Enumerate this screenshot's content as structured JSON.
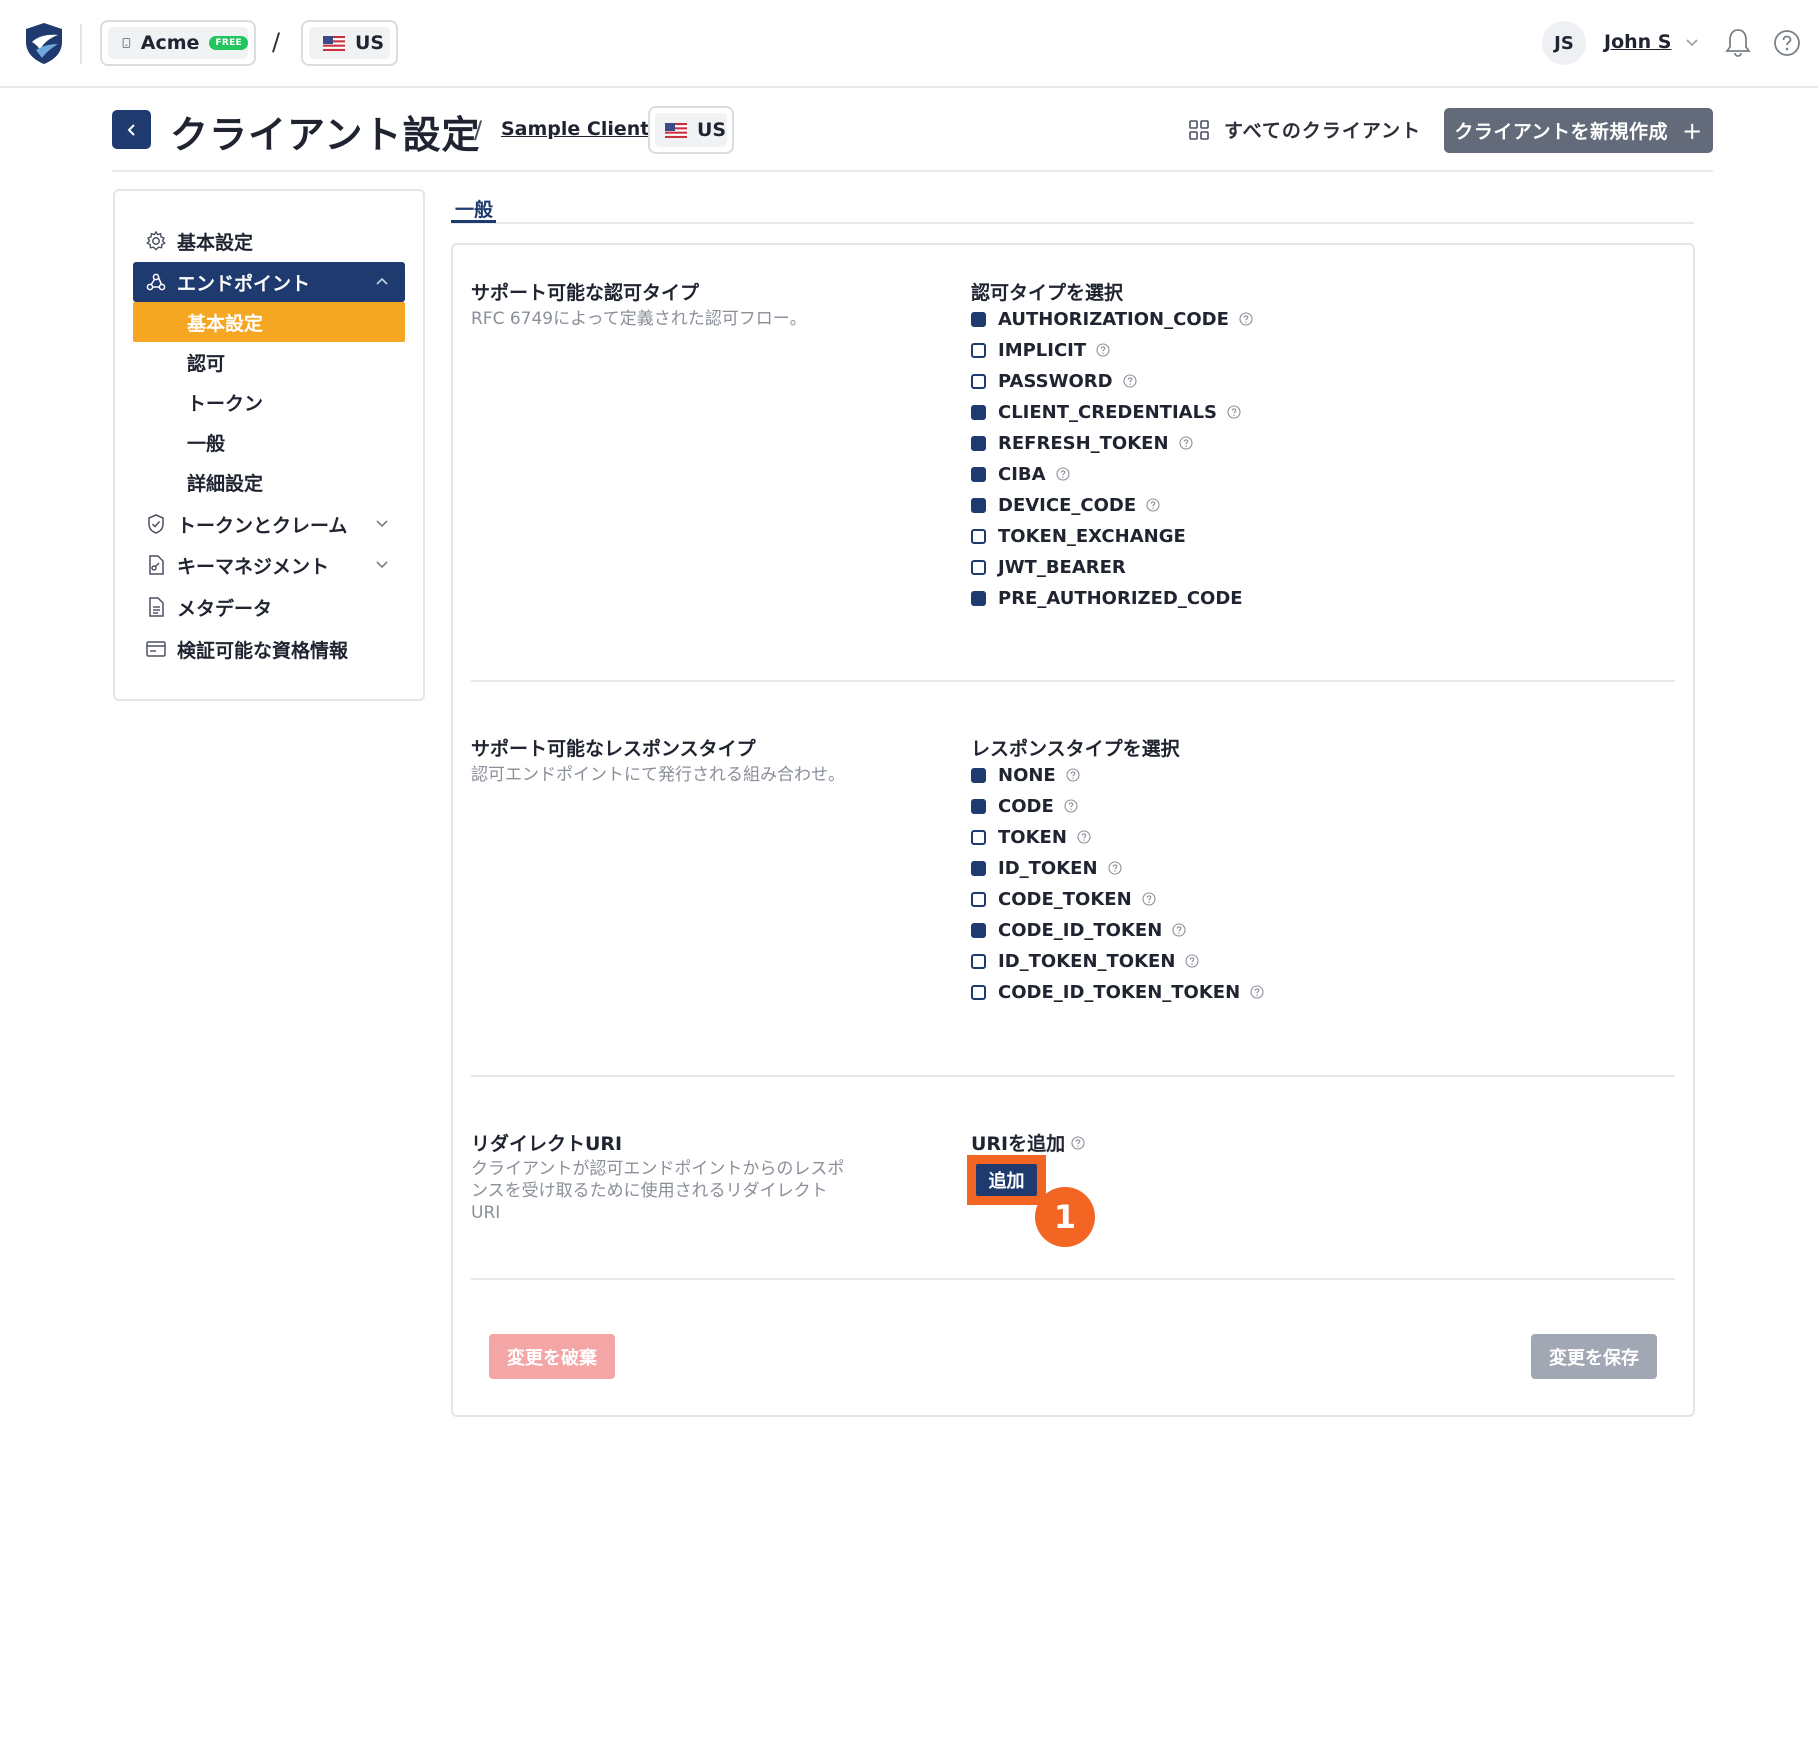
{
  "topbar": {
    "org_name": "Acme",
    "org_badge": "FREE",
    "separator": "/",
    "region": "US",
    "user_initials": "JS",
    "user_name": "John S"
  },
  "header": {
    "title": "クライアント設定",
    "separator": "/",
    "client_name": "Sample Client",
    "region": "US",
    "all_clients_label": "すべてのクライアント",
    "new_client_label": "クライアントを新規作成",
    "new_client_plus": "+"
  },
  "sidebar": {
    "items": [
      {
        "label": "基本設定",
        "icon": "gear-icon"
      },
      {
        "label": "エンドポイント",
        "icon": "webhook-icon",
        "active": true
      },
      {
        "label": "トークンとクレーム",
        "icon": "shield-check-icon"
      },
      {
        "label": "キーマネジメント",
        "icon": "key-file-icon"
      },
      {
        "label": "メタデータ",
        "icon": "document-icon"
      },
      {
        "label": "検証可能な資格情報",
        "icon": "credential-card-icon"
      }
    ],
    "sub_items": [
      {
        "label": "基本設定",
        "active": true
      },
      {
        "label": "認可"
      },
      {
        "label": "トークン"
      },
      {
        "label": "一般"
      },
      {
        "label": "詳細設定"
      }
    ]
  },
  "tabs": {
    "active": "一般"
  },
  "grant_types": {
    "title": "サポート可能な認可タイプ",
    "description": "RFC 6749によって定義された認可フロー。",
    "select_label": "認可タイプを選択",
    "options": [
      {
        "label": "AUTHORIZATION_CODE",
        "checked": true,
        "help": true
      },
      {
        "label": "IMPLICIT",
        "checked": false,
        "help": true
      },
      {
        "label": "PASSWORD",
        "checked": false,
        "help": true
      },
      {
        "label": "CLIENT_CREDENTIALS",
        "checked": true,
        "help": true
      },
      {
        "label": "REFRESH_TOKEN",
        "checked": true,
        "help": true
      },
      {
        "label": "CIBA",
        "checked": true,
        "help": true
      },
      {
        "label": "DEVICE_CODE",
        "checked": true,
        "help": true
      },
      {
        "label": "TOKEN_EXCHANGE",
        "checked": false,
        "help": false
      },
      {
        "label": "JWT_BEARER",
        "checked": false,
        "help": false
      },
      {
        "label": "PRE_AUTHORIZED_CODE",
        "checked": true,
        "help": false
      }
    ]
  },
  "response_types": {
    "title": "サポート可能なレスポンスタイプ",
    "description": "認可エンドポイントにて発行される組み合わせ。",
    "select_label": "レスポンスタイプを選択",
    "options": [
      {
        "label": "NONE",
        "checked": true
      },
      {
        "label": "CODE",
        "checked": true
      },
      {
        "label": "TOKEN",
        "checked": false
      },
      {
        "label": "ID_TOKEN",
        "checked": true
      },
      {
        "label": "CODE_TOKEN",
        "checked": false
      },
      {
        "label": "CODE_ID_TOKEN",
        "checked": true
      },
      {
        "label": "ID_TOKEN_TOKEN",
        "checked": false
      },
      {
        "label": "CODE_ID_TOKEN_TOKEN",
        "checked": false
      }
    ]
  },
  "redirect_uri": {
    "title": "リダイレクトURI",
    "description_line1": "クライアントが認可エンドポイントからのレスポ",
    "description_line2": "ンスを受け取るために使用されるリダイレクト",
    "description_line3": "URI",
    "add_label": "URIを追加",
    "add_button": "追加",
    "step_number": "1"
  },
  "footer": {
    "discard_label": "変更を破棄",
    "save_label": "変更を保存"
  },
  "colors": {
    "primary": "#1e3a6e",
    "accent_orange": "#f5a623",
    "highlight": "#f26522",
    "free_badge": "#22c55e"
  }
}
